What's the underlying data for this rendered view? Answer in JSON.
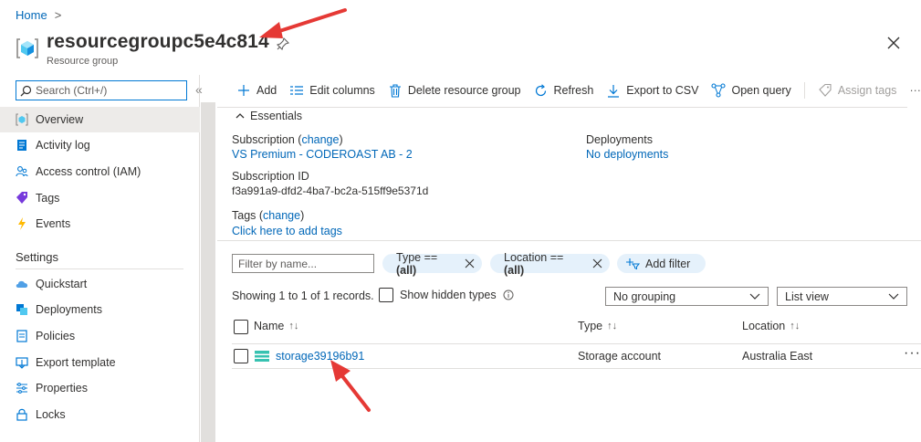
{
  "breadcrumb": {
    "home": "Home",
    "separator": ">"
  },
  "header": {
    "title": "resourcegroupc5e4c814",
    "subtitle": "Resource group"
  },
  "sidebar": {
    "search_placeholder": "Search (Ctrl+/)",
    "collapse": "«",
    "items": [
      {
        "label": "Overview",
        "icon": "resource-group-icon"
      },
      {
        "label": "Activity log",
        "icon": "activity-log-icon"
      },
      {
        "label": "Access control (IAM)",
        "icon": "people-icon"
      },
      {
        "label": "Tags",
        "icon": "tag-icon"
      },
      {
        "label": "Events",
        "icon": "lightning-icon"
      }
    ],
    "settings_header": "Settings",
    "settings_items": [
      {
        "label": "Quickstart",
        "icon": "cloud-icon"
      },
      {
        "label": "Deployments",
        "icon": "deployments-icon"
      },
      {
        "label": "Policies",
        "icon": "policies-icon"
      },
      {
        "label": "Export template",
        "icon": "export-template-icon"
      },
      {
        "label": "Properties",
        "icon": "properties-icon"
      },
      {
        "label": "Locks",
        "icon": "lock-icon"
      }
    ]
  },
  "toolbar": {
    "add": "Add",
    "edit_columns": "Edit columns",
    "delete": "Delete resource group",
    "refresh": "Refresh",
    "export_csv": "Export to CSV",
    "open_query": "Open query",
    "assign_tags": "Assign tags",
    "more": "···"
  },
  "essentials": {
    "header": "Essentials",
    "subscription_label": "Subscription",
    "subscription_change": "change",
    "subscription_value": "VS Premium - CODEROAST AB - 2",
    "subscription_id_label": "Subscription ID",
    "subscription_id_value": "f3a991a9-dfd2-4ba7-bc2a-515ff9e5371d",
    "tags_label": "Tags",
    "tags_change": "change",
    "tags_value": "Click here to add tags",
    "deployments_label": "Deployments",
    "deployments_value": "No deployments"
  },
  "filters": {
    "placeholder": "Filter by name...",
    "type_pill_label": "Type ==",
    "type_pill_value": "(all)",
    "location_pill_label": "Location ==",
    "location_pill_value": "(all)",
    "add_filter": "Add filter"
  },
  "list": {
    "records_text": "Showing 1 to 1 of 1 records.",
    "show_hidden": "Show hidden types",
    "grouping": "No grouping",
    "view": "List view",
    "columns": [
      "Name",
      "Type",
      "Location"
    ],
    "rows": [
      {
        "name": "storage39196b91",
        "type": "Storage account",
        "location": "Australia East"
      }
    ],
    "row_more": "···"
  },
  "colors": {
    "accent": "#0078d4",
    "link": "#0067b8",
    "annotation_arrow": "#e53935"
  }
}
